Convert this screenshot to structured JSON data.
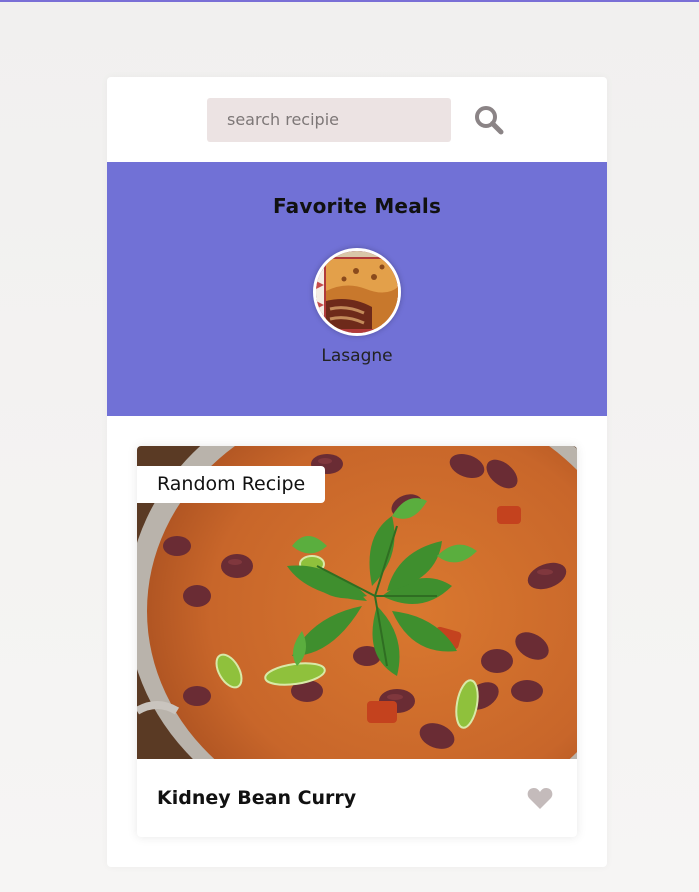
{
  "search": {
    "placeholder": "search recipie",
    "value": "",
    "button_icon": "search-icon"
  },
  "favorites": {
    "title": "Favorite Meals",
    "items": [
      {
        "name": "Lasagne"
      }
    ]
  },
  "random_meal": {
    "tag": "Random Recipe",
    "title": "Kidney Bean Curry",
    "favorite_icon": "heart-icon",
    "is_favorite": false
  },
  "colors": {
    "accent": "#7171d6",
    "search_bg": "#ece3e3",
    "icon_gray": "#8b8486",
    "heart_gray": "#c4bbbb"
  }
}
